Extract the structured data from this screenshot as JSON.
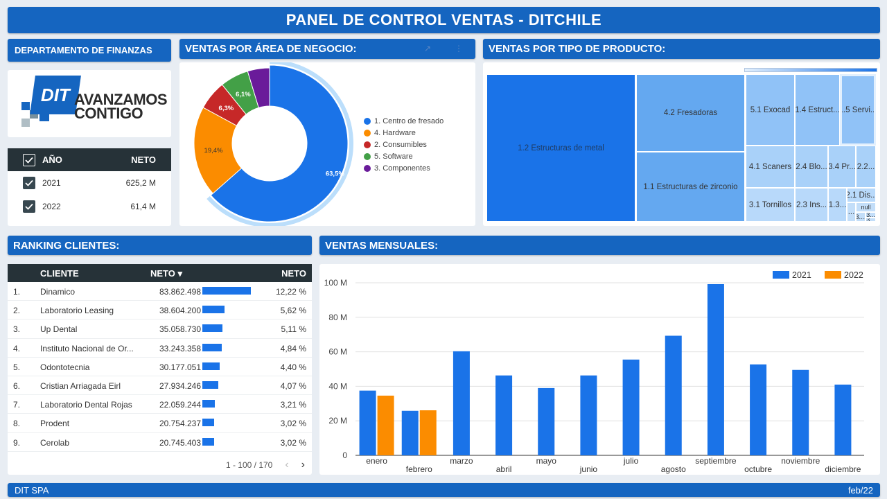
{
  "header": {
    "title": "PANEL DE CONTROL VENTAS - DITCHILE"
  },
  "dept": {
    "title": "DEPARTAMENTO DE FINANZAS"
  },
  "logo": {
    "brand": "DIT",
    "line1": "AVANZAMOS",
    "line2": "CONTIGO"
  },
  "year_table": {
    "col_year": "AÑO",
    "col_net": "NETO",
    "rows": [
      {
        "year": "2021",
        "net": "625,2 M"
      },
      {
        "year": "2022",
        "net": "61,4 M"
      }
    ]
  },
  "area": {
    "title": "VENTAS POR ÁREA DE NEGOCIO:",
    "toolbar": [
      "↗",
      "⋮"
    ],
    "chart_data": {
      "type": "pie",
      "slices": [
        {
          "label": "1. Centro de fresado",
          "value": 63.5,
          "text": "63,5%",
          "color": "#1a73e8"
        },
        {
          "label": "4. Hardware",
          "value": 19.4,
          "text": "19,4%",
          "color": "#fb8c00"
        },
        {
          "label": "2. Consumibles",
          "value": 6.3,
          "text": "6,3%",
          "color": "#c62828"
        },
        {
          "label": "5. Software",
          "value": 6.1,
          "text": "6,1%",
          "color": "#43a047"
        },
        {
          "label": "3. Componentes",
          "value": 4.7,
          "text": "",
          "color": "#6a1b9a"
        }
      ]
    }
  },
  "product": {
    "title": "VENTAS POR TIPO DE PRODUCTO:",
    "tiles": [
      "1.2 Estructuras de metal",
      "4.2 Fresadoras",
      "1.1 Estructuras de zirconio",
      "5.1 Exocad",
      "1.4 Estruct...",
      "1.5 Servi...",
      "4.1 Scaners",
      "2.4 Blo...",
      "3.4 Pr...",
      "2.2...",
      "3.1 Tornillos",
      "2.3 Ins...",
      "1.3...",
      "2.1 Dis...",
      "null",
      "...",
      "3....",
      "3...",
      "3..."
    ]
  },
  "ranking": {
    "title": "RANKING CLIENTES:",
    "col_client": "CLIENTE",
    "col_net_sort": "NETO ▾",
    "col_net": "NETO",
    "rows": [
      {
        "idx": "1.",
        "name": "Dinamico",
        "net": "83.862.498",
        "pct": "12,22 %",
        "share": 12.22
      },
      {
        "idx": "2.",
        "name": "Laboratorio Leasing",
        "net": "38.604.200",
        "pct": "5,62 %",
        "share": 5.62
      },
      {
        "idx": "3.",
        "name": "Up Dental",
        "net": "35.058.730",
        "pct": "5,11 %",
        "share": 5.11
      },
      {
        "idx": "4.",
        "name": "Instituto Nacional de Or...",
        "net": "33.243.358",
        "pct": "4,84 %",
        "share": 4.84
      },
      {
        "idx": "5.",
        "name": "Odontotecnia",
        "net": "30.177.051",
        "pct": "4,40 %",
        "share": 4.4
      },
      {
        "idx": "6.",
        "name": "Cristian Arriagada Eirl",
        "net": "27.934.246",
        "pct": "4,07 %",
        "share": 4.07
      },
      {
        "idx": "7.",
        "name": "Laboratorio Dental Rojas",
        "net": "22.059.244",
        "pct": "3,21 %",
        "share": 3.21
      },
      {
        "idx": "8.",
        "name": "Prodent",
        "net": "20.754.237",
        "pct": "3,02 %",
        "share": 3.02
      },
      {
        "idx": "9.",
        "name": "Cerolab",
        "net": "20.745.403",
        "pct": "3,02 %",
        "share": 3.02
      }
    ],
    "pager": "1 - 100 / 170"
  },
  "monthly": {
    "title": "VENTAS MENSUALES:",
    "chart_data": {
      "type": "bar",
      "categories": [
        "enero",
        "febrero",
        "marzo",
        "abril",
        "mayo",
        "junio",
        "julio",
        "agosto",
        "septiembre",
        "octubre",
        "noviembre",
        "diciembre"
      ],
      "series": [
        {
          "name": "2021",
          "color": "#1a73e8",
          "values": [
            37.5,
            25.8,
            60.3,
            46.3,
            39.0,
            46.3,
            55.5,
            69.3,
            99.2,
            52.7,
            49.5,
            41.0
          ]
        },
        {
          "name": "2022",
          "color": "#fb8c00",
          "values": [
            34.6,
            26.1,
            null,
            null,
            null,
            null,
            null,
            null,
            null,
            null,
            null,
            null
          ]
        }
      ],
      "yticks": [
        "0",
        "20 M",
        "40 M",
        "60 M",
        "80 M",
        "100 M"
      ],
      "ylim": [
        0,
        100
      ],
      "legend": "top-right"
    }
  },
  "footer": {
    "left": "DIT SPA",
    "right": "feb/22"
  }
}
